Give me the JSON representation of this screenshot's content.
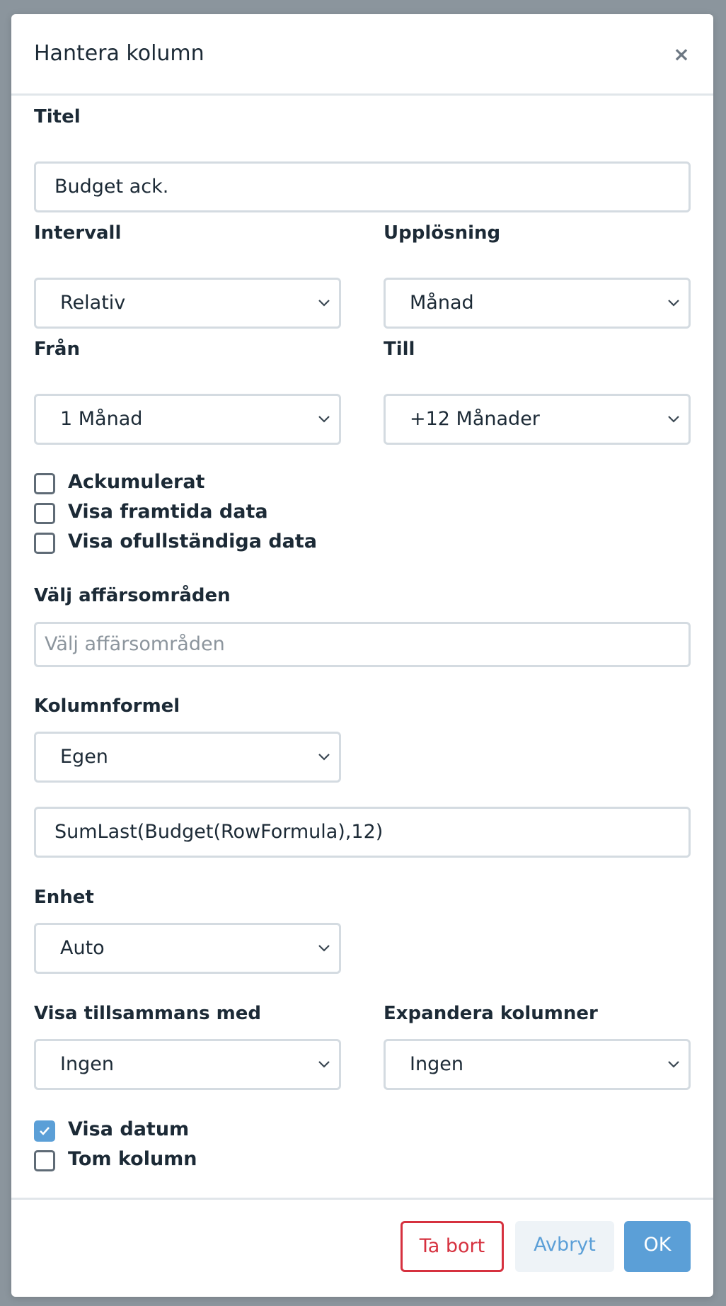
{
  "dialog": {
    "title": "Hantera kolumn",
    "close_symbol": "×"
  },
  "fields": {
    "title_label": "Titel",
    "title_value": "Budget ack.",
    "interval_label": "Intervall",
    "interval_value": "Relativ",
    "resolution_label": "Upplösning",
    "resolution_value": "Månad",
    "from_label": "Från",
    "from_value": "1 Månad",
    "to_label": "Till",
    "to_value": "+12 Månader",
    "business_areas_label": "Välj affärsområden",
    "business_areas_placeholder": "Välj affärsområden",
    "formula_label": "Kolumnformel",
    "formula_type_value": "Egen",
    "formula_value": "SumLast(Budget(RowFormula),12)",
    "unit_label": "Enhet",
    "unit_value": "Auto",
    "show_with_label": "Visa tillsammans med",
    "show_with_value": "Ingen",
    "expand_label": "Expandera kolumner",
    "expand_value": "Ingen"
  },
  "checkboxes_top": [
    {
      "label": "Ackumulerat",
      "checked": false
    },
    {
      "label": "Visa framtida data",
      "checked": false
    },
    {
      "label": "Visa ofullständiga data",
      "checked": false
    }
  ],
  "checkboxes_bottom": [
    {
      "label": "Visa datum",
      "checked": true
    },
    {
      "label": "Tom kolumn",
      "checked": false
    }
  ],
  "buttons": {
    "delete_label": "Ta bort",
    "cancel_label": "Avbryt",
    "ok_label": "OK"
  },
  "colors": {
    "accent": "#5b9fd7",
    "danger": "#d6313f",
    "text": "#1c2a36",
    "border": "#d4dbe1"
  }
}
